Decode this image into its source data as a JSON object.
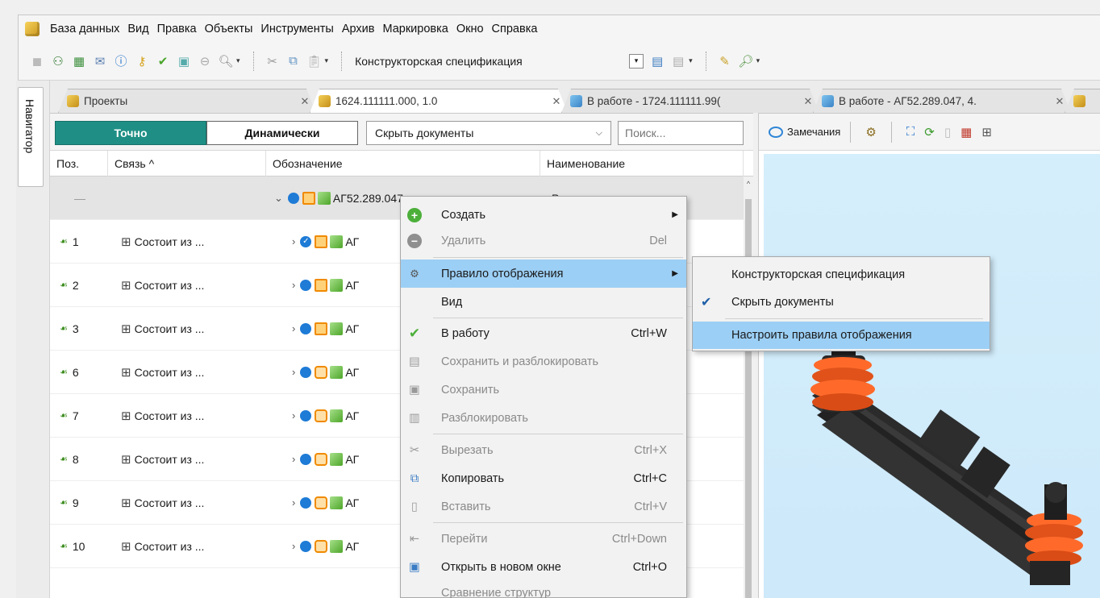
{
  "menubar": {
    "items": [
      "База данных",
      "Вид",
      "Правка",
      "Объекты",
      "Инструменты",
      "Архив",
      "Маркировка",
      "Окно",
      "Справка"
    ]
  },
  "toolbar": {
    "spec_label": "Конструкторская спецификация"
  },
  "navigator": {
    "label": "Навигатор"
  },
  "tabs": [
    {
      "label": "Проекты",
      "icon": "cube-icon"
    },
    {
      "label": "1624.111111.000, 1.0",
      "icon": "cube-icon"
    },
    {
      "label": "В работе - 1724.111111.99(",
      "icon": "blue-cube-icon"
    },
    {
      "label": "В работе - АГ52.289.047, 4.",
      "icon": "blue-cube-icon"
    }
  ],
  "filter": {
    "exact": "Точно",
    "dynamic": "Динамически",
    "select_value": "Скрыть документы",
    "search_placeholder": "Поиск..."
  },
  "table": {
    "columns": [
      "Поз.",
      "Связь ^",
      "Обозначение",
      "Наименование"
    ],
    "selected_row": {
      "pos": "—",
      "designation": "АГ52.289.047",
      "name": "Рессорная подвеска"
    },
    "rows": [
      {
        "pos": "1",
        "relation": "Состоит из ...",
        "designation": "АГ"
      },
      {
        "pos": "2",
        "relation": "Состоит из ...",
        "designation": "АГ"
      },
      {
        "pos": "3",
        "relation": "Состоит из ...",
        "designation": "АГ"
      },
      {
        "pos": "6",
        "relation": "Состоит из ...",
        "designation": "АГ"
      },
      {
        "pos": "7",
        "relation": "Состоит из ...",
        "designation": "АГ"
      },
      {
        "pos": "8",
        "relation": "Состоит из ...",
        "designation": "АГ"
      },
      {
        "pos": "9",
        "relation": "Состоит из ...",
        "designation": "АГ"
      },
      {
        "pos": "10",
        "relation": "Состоит из ...",
        "designation": "АГ"
      }
    ]
  },
  "right_panel": {
    "remarks": "Замечания"
  },
  "context_menu": {
    "items": [
      {
        "label": "Создать",
        "shortcut": "",
        "submenu": true
      },
      {
        "label": "Удалить",
        "shortcut": "Del"
      },
      {
        "label": "Правило отображения",
        "shortcut": "",
        "submenu": true
      },
      {
        "label": "Вид",
        "shortcut": ""
      },
      {
        "label": "В работу",
        "shortcut": "Ctrl+W"
      },
      {
        "label": "Сохранить и разблокировать",
        "shortcut": ""
      },
      {
        "label": "Сохранить",
        "shortcut": ""
      },
      {
        "label": "Разблокировать",
        "shortcut": ""
      },
      {
        "label": "Вырезать",
        "shortcut": "Ctrl+X"
      },
      {
        "label": "Копировать",
        "shortcut": "Ctrl+C"
      },
      {
        "label": "Вставить",
        "shortcut": "Ctrl+V"
      },
      {
        "label": "Перейти",
        "shortcut": "Ctrl+Down"
      },
      {
        "label": "Открыть в новом окне",
        "shortcut": "Ctrl+O"
      },
      {
        "label": "Сравнение структур",
        "shortcut": ""
      }
    ]
  },
  "submenu": {
    "items": [
      "Конструкторская спецификация",
      "Скрыть документы",
      "Настроить правила отображения"
    ]
  },
  "colors": {
    "accent_teal": "#1f8f85",
    "highlight": "#9ccff5",
    "status_blue": "#1e7bd6"
  }
}
